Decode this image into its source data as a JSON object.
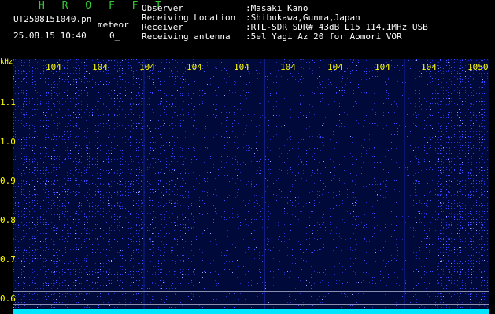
{
  "header": {
    "title": "H R O F F T",
    "filename": "UT2508151040.pn",
    "detection_label": "meteor",
    "datetime": "25.08.15 10:40",
    "counter": "0_"
  },
  "station_info": [
    {
      "label": "Observer",
      "value": ":Masaki Kano"
    },
    {
      "label": "Receiving Location",
      "value": ":Shibukawa,Gunma,Japan"
    },
    {
      "label": "Receiver",
      "value": ":RTL-SDR SDR# 43dB L15 114.1MHz USB"
    },
    {
      "label": "Receiving antenna",
      "value": ":5el Yagi Az 20 for Aomori VOR"
    }
  ],
  "spectrogram": {
    "y_unit": "kHz",
    "x_ticks": [
      "104",
      "104",
      "104",
      "104",
      "104",
      "104",
      "104",
      "104",
      "104",
      "1050"
    ],
    "y_ticks": [
      "1.1",
      "1.0",
      "0.9",
      "0.8",
      "0.7",
      "0.6"
    ],
    "colors": {
      "background": "#000a3a",
      "noise": "#2a3cff",
      "text_axis": "#ffff00",
      "title": "#33cc33",
      "baseline": "#00e5ff"
    }
  }
}
